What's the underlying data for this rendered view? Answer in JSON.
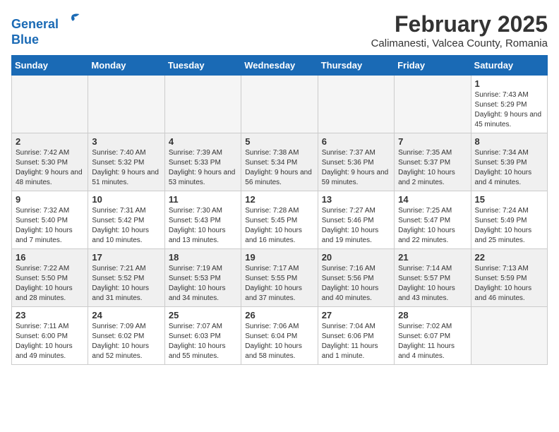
{
  "logo": {
    "line1": "General",
    "line2": "Blue"
  },
  "title": "February 2025",
  "location": "Calimanesti, Valcea County, Romania",
  "headers": [
    "Sunday",
    "Monday",
    "Tuesday",
    "Wednesday",
    "Thursday",
    "Friday",
    "Saturday"
  ],
  "weeks": [
    {
      "shaded": false,
      "days": [
        {
          "num": "",
          "info": ""
        },
        {
          "num": "",
          "info": ""
        },
        {
          "num": "",
          "info": ""
        },
        {
          "num": "",
          "info": ""
        },
        {
          "num": "",
          "info": ""
        },
        {
          "num": "",
          "info": ""
        },
        {
          "num": "1",
          "info": "Sunrise: 7:43 AM\nSunset: 5:29 PM\nDaylight: 9 hours and 45 minutes."
        }
      ]
    },
    {
      "shaded": true,
      "days": [
        {
          "num": "2",
          "info": "Sunrise: 7:42 AM\nSunset: 5:30 PM\nDaylight: 9 hours and 48 minutes."
        },
        {
          "num": "3",
          "info": "Sunrise: 7:40 AM\nSunset: 5:32 PM\nDaylight: 9 hours and 51 minutes."
        },
        {
          "num": "4",
          "info": "Sunrise: 7:39 AM\nSunset: 5:33 PM\nDaylight: 9 hours and 53 minutes."
        },
        {
          "num": "5",
          "info": "Sunrise: 7:38 AM\nSunset: 5:34 PM\nDaylight: 9 hours and 56 minutes."
        },
        {
          "num": "6",
          "info": "Sunrise: 7:37 AM\nSunset: 5:36 PM\nDaylight: 9 hours and 59 minutes."
        },
        {
          "num": "7",
          "info": "Sunrise: 7:35 AM\nSunset: 5:37 PM\nDaylight: 10 hours and 2 minutes."
        },
        {
          "num": "8",
          "info": "Sunrise: 7:34 AM\nSunset: 5:39 PM\nDaylight: 10 hours and 4 minutes."
        }
      ]
    },
    {
      "shaded": false,
      "days": [
        {
          "num": "9",
          "info": "Sunrise: 7:32 AM\nSunset: 5:40 PM\nDaylight: 10 hours and 7 minutes."
        },
        {
          "num": "10",
          "info": "Sunrise: 7:31 AM\nSunset: 5:42 PM\nDaylight: 10 hours and 10 minutes."
        },
        {
          "num": "11",
          "info": "Sunrise: 7:30 AM\nSunset: 5:43 PM\nDaylight: 10 hours and 13 minutes."
        },
        {
          "num": "12",
          "info": "Sunrise: 7:28 AM\nSunset: 5:45 PM\nDaylight: 10 hours and 16 minutes."
        },
        {
          "num": "13",
          "info": "Sunrise: 7:27 AM\nSunset: 5:46 PM\nDaylight: 10 hours and 19 minutes."
        },
        {
          "num": "14",
          "info": "Sunrise: 7:25 AM\nSunset: 5:47 PM\nDaylight: 10 hours and 22 minutes."
        },
        {
          "num": "15",
          "info": "Sunrise: 7:24 AM\nSunset: 5:49 PM\nDaylight: 10 hours and 25 minutes."
        }
      ]
    },
    {
      "shaded": true,
      "days": [
        {
          "num": "16",
          "info": "Sunrise: 7:22 AM\nSunset: 5:50 PM\nDaylight: 10 hours and 28 minutes."
        },
        {
          "num": "17",
          "info": "Sunrise: 7:21 AM\nSunset: 5:52 PM\nDaylight: 10 hours and 31 minutes."
        },
        {
          "num": "18",
          "info": "Sunrise: 7:19 AM\nSunset: 5:53 PM\nDaylight: 10 hours and 34 minutes."
        },
        {
          "num": "19",
          "info": "Sunrise: 7:17 AM\nSunset: 5:55 PM\nDaylight: 10 hours and 37 minutes."
        },
        {
          "num": "20",
          "info": "Sunrise: 7:16 AM\nSunset: 5:56 PM\nDaylight: 10 hours and 40 minutes."
        },
        {
          "num": "21",
          "info": "Sunrise: 7:14 AM\nSunset: 5:57 PM\nDaylight: 10 hours and 43 minutes."
        },
        {
          "num": "22",
          "info": "Sunrise: 7:13 AM\nSunset: 5:59 PM\nDaylight: 10 hours and 46 minutes."
        }
      ]
    },
    {
      "shaded": false,
      "days": [
        {
          "num": "23",
          "info": "Sunrise: 7:11 AM\nSunset: 6:00 PM\nDaylight: 10 hours and 49 minutes."
        },
        {
          "num": "24",
          "info": "Sunrise: 7:09 AM\nSunset: 6:02 PM\nDaylight: 10 hours and 52 minutes."
        },
        {
          "num": "25",
          "info": "Sunrise: 7:07 AM\nSunset: 6:03 PM\nDaylight: 10 hours and 55 minutes."
        },
        {
          "num": "26",
          "info": "Sunrise: 7:06 AM\nSunset: 6:04 PM\nDaylight: 10 hours and 58 minutes."
        },
        {
          "num": "27",
          "info": "Sunrise: 7:04 AM\nSunset: 6:06 PM\nDaylight: 11 hours and 1 minute."
        },
        {
          "num": "28",
          "info": "Sunrise: 7:02 AM\nSunset: 6:07 PM\nDaylight: 11 hours and 4 minutes."
        },
        {
          "num": "",
          "info": ""
        }
      ]
    }
  ]
}
